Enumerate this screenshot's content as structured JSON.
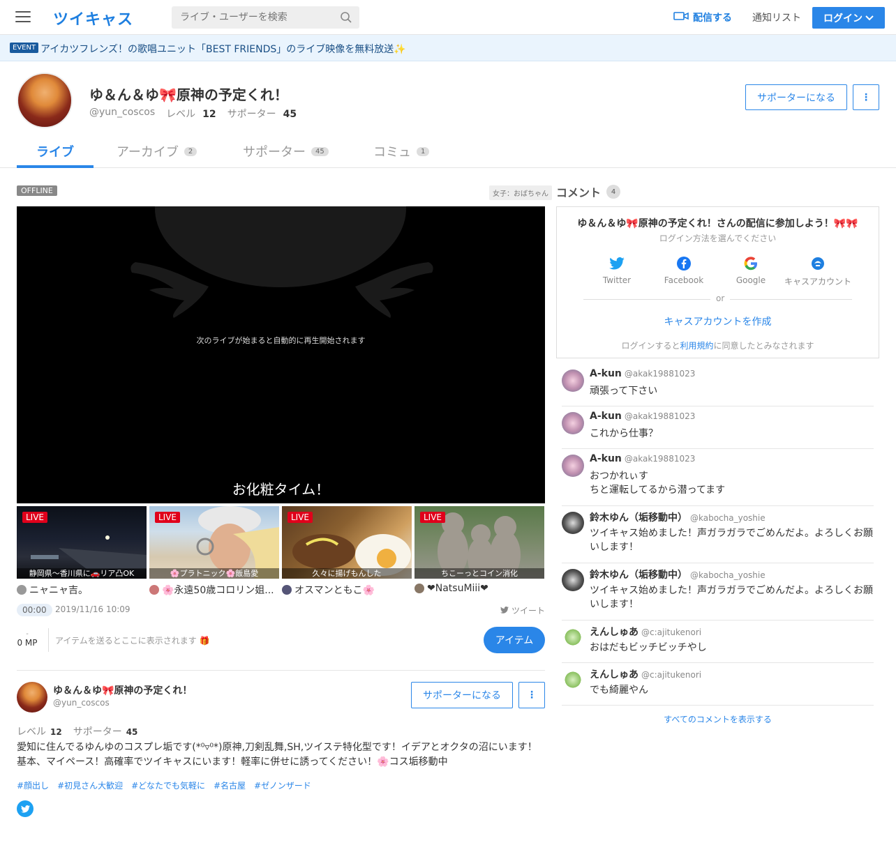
{
  "header": {
    "logo": "ツイキャス",
    "search_placeholder": "ライブ・ユーザーを検索",
    "broadcast_label": "配信する",
    "notify_label": "通知リスト",
    "login_label": "ログイン"
  },
  "event": {
    "badge": "EVENT",
    "text": "アイカツフレンズ！の歌唱ユニット「BEST FRIENDS」のライブ映像を無料放送✨"
  },
  "profile": {
    "name": "ゆ＆ん＆ゆ🎀原神の予定くれ！",
    "handle": "@yun_coscos",
    "level_label": "レベル",
    "level": "12",
    "supporter_label": "サポーター",
    "supporters": "45",
    "supporter_button": "サポーターになる",
    "more": "⋮"
  },
  "tabs": [
    {
      "label": "ライブ",
      "count": ""
    },
    {
      "label": "アーカイブ",
      "count": "2"
    },
    {
      "label": "サポーター",
      "count": "45"
    },
    {
      "label": "コミュ",
      "count": "1"
    }
  ],
  "player": {
    "status": "OFFLINE",
    "category": "女子：おばちゃん",
    "message": "次のライブが始まると自動的に再生開始されます",
    "title": "お化粧タイム！"
  },
  "thumbs": [
    {
      "live": "LIVE",
      "caption": "静岡県～香川県に🚗リア凸OK",
      "owner": "ニャニャ吉。"
    },
    {
      "live": "LIVE",
      "caption": "🌸プラトニック🌸飯島愛",
      "owner": "🌸永遠50歳コロリン姐..."
    },
    {
      "live": "LIVE",
      "caption": "久々に揚げもんした",
      "owner": "オスマンともこ🌸"
    },
    {
      "live": "LIVE",
      "caption": "ちこーっとコイン消化",
      "owner": "❤NatsuMiii❤"
    }
  ],
  "stats": {
    "time": "00:00",
    "date": "2019/11/16 10:09",
    "tweet": "ツイート",
    "mp_dash": "-",
    "mp": "0 MP",
    "item_text": "アイテムを送るとここに表示されます 🎁",
    "item_button": "アイテム"
  },
  "bio": {
    "name": "ゆ＆ん＆ゆ🎀原神の予定くれ！",
    "handle": "@yun_coscos",
    "supporter_button": "サポーターになる",
    "more": "⋮",
    "level_label": "レベル",
    "level": "12",
    "supporter_label": "サポーター",
    "supporters": "45",
    "description": "愛知に住んでるゆんゆのコスプレ垢です(*⁰▿⁰*)原神,刀剣乱舞,SH,ツイステ特化型です！イデアとオクタの沼にいます！基本、マイペース！高確率でツイキャスにいます！軽率に併せに誘ってください！🌸コス垢移動中",
    "tags": [
      "#顔出し",
      "#初見さん大歓迎",
      "#どなたでも気軽に",
      "#名古屋",
      "#ゼノンザード"
    ]
  },
  "comments_panel": {
    "title": "コメント",
    "count": "4",
    "login_heading": "ゆ＆ん＆ゆ🎀原神の予定くれ！さんの配信に参加しよう！🎀🎀",
    "login_sub": "ログイン方法を選んでください",
    "sns": [
      "Twitter",
      "Facebook",
      "Google",
      "キャスアカウント"
    ],
    "or": "or",
    "create": "キャスアカウントを作成",
    "terms_prefix": "ログインすると",
    "terms_link": "利用規約",
    "terms_suffix": "に同意したとみなされます",
    "show_all": "すべてのコメントを表示する"
  },
  "comments": [
    {
      "name": "A-kun",
      "handle": "@akak19881023",
      "text": "頑張って下さい"
    },
    {
      "name": "A-kun",
      "handle": "@akak19881023",
      "text": "これから仕事？"
    },
    {
      "name": "A-kun",
      "handle": "@akak19881023",
      "text": "おつかれぃす\nちと運転してるから潜ってます"
    },
    {
      "name": "鈴木ゆん（垢移動中）",
      "handle": "@kabocha_yoshie",
      "text": "ツイキャス始めました！声ガラガラでごめんだよ。よろしくお願いします！"
    },
    {
      "name": "鈴木ゆん（垢移動中）",
      "handle": "@kabocha_yoshie",
      "text": "ツイキャス始めました！声ガラガラでごめんだよ。よろしくお願いします！"
    },
    {
      "name": "えんしゅあ",
      "handle": "@c:ajitukenori",
      "text": "おはだもビッチビッチやし"
    },
    {
      "name": "えんしゅあ",
      "handle": "@c:ajitukenori",
      "text": "でも綺麗やん"
    }
  ]
}
